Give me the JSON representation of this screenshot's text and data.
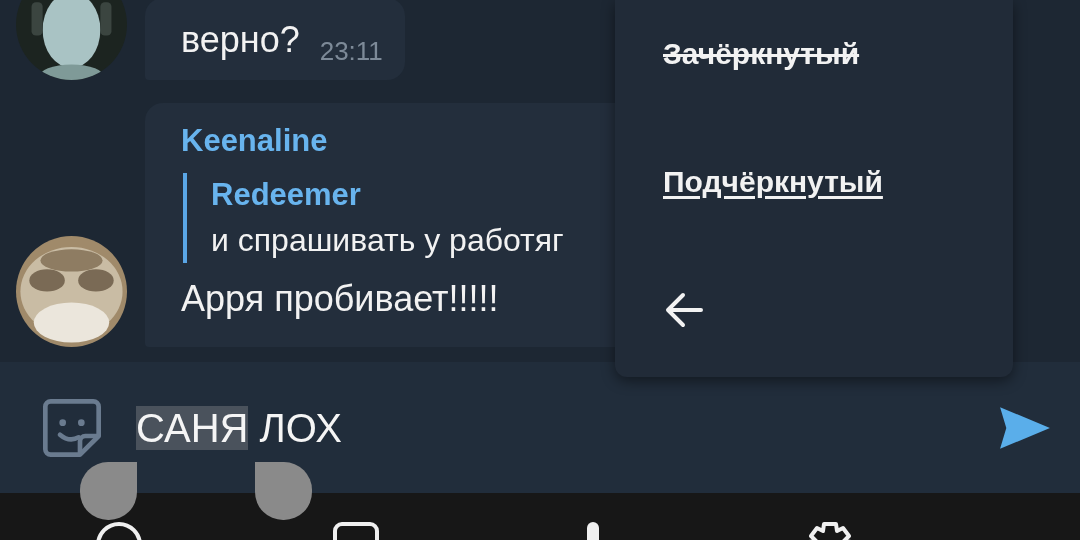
{
  "messages": [
    {
      "text": "верно?",
      "time": "23:11"
    },
    {
      "sender": "Keenaline",
      "reply": {
        "sender": "Redeemer",
        "text": "и спрашивать у работяг"
      },
      "text": "Арря пробивает!!!!!"
    }
  ],
  "format_menu": {
    "items": [
      {
        "kind": "strikethrough",
        "label": "Зачёркнутый"
      },
      {
        "kind": "underline",
        "label": "Подчёркнутый"
      },
      {
        "kind": "back"
      }
    ]
  },
  "composer": {
    "parts": [
      {
        "text": "САНЯ",
        "selected": true
      },
      {
        "text": "ЛОХ",
        "selected": false
      }
    ]
  },
  "nav_bar": {
    "items": [
      {
        "kind": "circle"
      },
      {
        "kind": "square"
      },
      {
        "kind": "bar"
      },
      {
        "kind": "gear"
      }
    ]
  }
}
